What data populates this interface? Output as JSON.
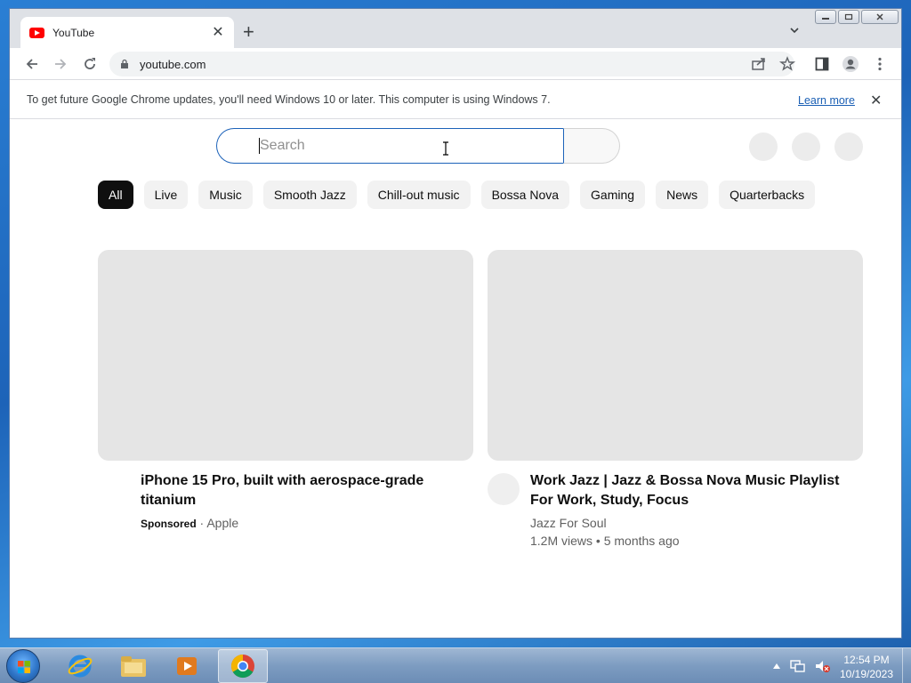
{
  "browser": {
    "tab_title": "YouTube",
    "tab_close": "✕",
    "new_tab": "+",
    "address": "youtube.com"
  },
  "infobar": {
    "message": "To get future Google Chrome updates, you'll need Windows 10 or later. This computer is using Windows 7.",
    "learn_more": "Learn more",
    "close": "✕"
  },
  "search": {
    "placeholder": "Search"
  },
  "chips": [
    "All",
    "Live",
    "Music",
    "Smooth Jazz",
    "Chill-out music",
    "Bossa Nova",
    "Gaming",
    "News",
    "Quarterbacks"
  ],
  "videos": [
    {
      "title": "iPhone 15 Pro, built with aerospace-grade titanium",
      "sponsored": "Sponsored",
      "separator": " · ",
      "advertiser": "Apple"
    },
    {
      "title": "Work Jazz | Jazz & Bossa Nova Music Playlist For Work, Study, Focus",
      "channel": "Jazz For Soul",
      "stats": "1.2M views • 5 months ago"
    }
  ],
  "taskbar": {
    "time": "12:54 PM",
    "date": "10/19/2023"
  }
}
